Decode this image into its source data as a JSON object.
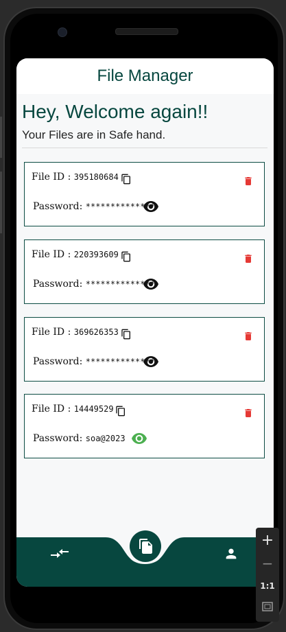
{
  "app": {
    "title": "File Manager"
  },
  "welcome": {
    "heading": "Hey, Welcome again!!",
    "subtitle": "Your Files are in Safe hand."
  },
  "files": [
    {
      "id_label": "File ID :",
      "id": "395180684",
      "password_label": "Password:",
      "password": "**************",
      "revealed": false
    },
    {
      "id_label": "File ID :",
      "id": "220393609",
      "password_label": "Password:",
      "password": "**************",
      "revealed": false
    },
    {
      "id_label": "File ID :",
      "id": "369626353",
      "password_label": "Password:",
      "password": "**************",
      "revealed": false
    },
    {
      "id_label": "File ID :",
      "id": "14449529",
      "password_label": "Password:",
      "password": "soa@2023",
      "revealed": true
    }
  ],
  "zoom_controls": {
    "plus": "+",
    "minus": "−",
    "ratio": "1:1"
  },
  "icons": {
    "copy": "copy-icon",
    "delete": "trash-icon",
    "eye": "eye-icon",
    "nav_left": "swap-arrows-icon",
    "nav_center": "files-icon",
    "nav_right": "person-icon"
  },
  "colors": {
    "primary": "#07473f",
    "danger": "#e53935",
    "revealed": "#4caf50"
  }
}
